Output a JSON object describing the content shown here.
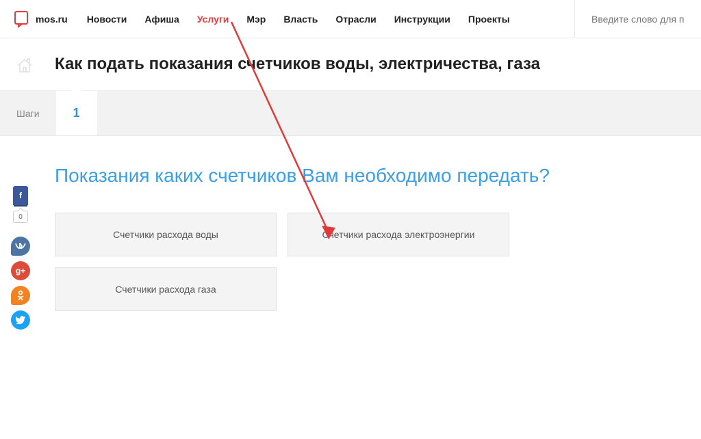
{
  "header": {
    "logo_text": "mos.ru",
    "nav": {
      "items": [
        "Новости",
        "Афиша",
        "Услуги",
        "Мэр",
        "Власть",
        "Отрасли",
        "Инструкции",
        "Проекты"
      ],
      "active_index": 2
    },
    "search_placeholder": "Введите слово для п"
  },
  "page_title": "Как подать показания счетчиков воды, электричества, газа",
  "steps": {
    "label": "Шаги",
    "current": "1"
  },
  "content": {
    "question": "Показания каких счетчиков Вам необходимо передать?",
    "options": [
      "Счетчики расхода воды",
      "Счетчики расхода электроэнергии",
      "Счетчики расхода газа"
    ]
  },
  "social": {
    "fb": "f",
    "count": "0",
    "vk": "vk",
    "gp": "g+",
    "ok": "ok",
    "tw": "t"
  },
  "colors": {
    "accent_red": "#e63939",
    "accent_blue": "#3a9fe8"
  }
}
